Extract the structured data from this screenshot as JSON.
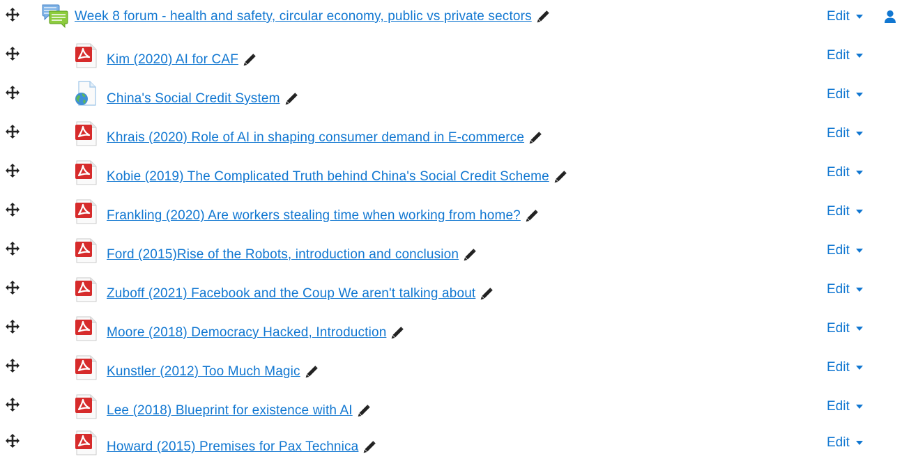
{
  "forum": {
    "title": "Week 8 forum - health and safety, circular economy, public vs private sectors",
    "edit_label": "Edit",
    "icon": "forum-icon"
  },
  "items": [
    {
      "title": "Kim (2020) AI for CAF",
      "icon": "pdf-icon",
      "edit_label": "Edit"
    },
    {
      "title": "China's Social Credit System",
      "icon": "url-icon",
      "edit_label": "Edit"
    },
    {
      "title": "Khrais (2020) Role of AI in shaping consumer demand in E-commerce",
      "icon": "pdf-icon",
      "edit_label": "Edit"
    },
    {
      "title": "Kobie (2019) The Complicated Truth behind China's Social Credit Scheme",
      "icon": "pdf-icon",
      "edit_label": "Edit"
    },
    {
      "title": "Frankling (2020) Are workers stealing time when working from home?",
      "icon": "pdf-icon",
      "edit_label": "Edit"
    },
    {
      "title": "Ford (2015)Rise of the Robots, introduction and conclusion",
      "icon": "pdf-icon",
      "edit_label": "Edit"
    },
    {
      "title": "Zuboff (2021) Facebook and the Coup We aren't talking about",
      "icon": "pdf-icon",
      "edit_label": "Edit"
    },
    {
      "title": "Moore (2018) Democracy Hacked, Introduction",
      "icon": "pdf-icon",
      "edit_label": "Edit"
    },
    {
      "title": "Kunstler (2012) Too Much Magic",
      "icon": "pdf-icon",
      "edit_label": "Edit"
    },
    {
      "title": "Lee (2018) Blueprint for existence with AI",
      "icon": "pdf-icon",
      "edit_label": "Edit"
    },
    {
      "title": "Howard (2015) Premises for Pax Technica",
      "icon": "pdf-icon",
      "edit_label": "Edit"
    }
  ],
  "colors": {
    "link": "#1177d1",
    "pdf": "#d62b2b"
  }
}
